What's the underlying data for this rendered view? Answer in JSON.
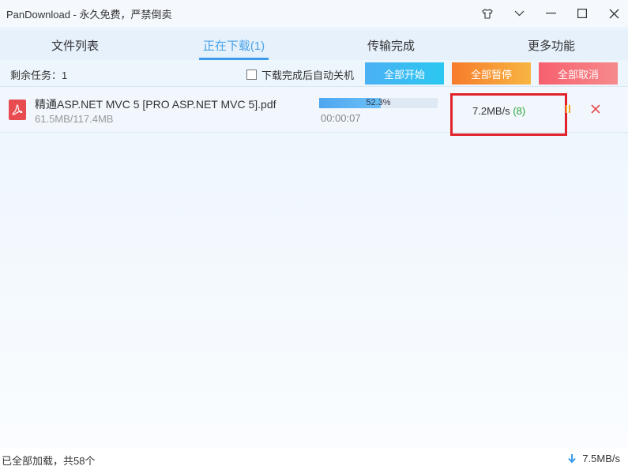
{
  "window": {
    "title": "PanDownload - 永久免费，严禁倒卖",
    "controls": [
      "shirt-skin-icon",
      "chevron-down-icon",
      "minimize-icon",
      "maximize-icon",
      "close-icon"
    ]
  },
  "tabs": [
    {
      "label": "文件列表",
      "active": false
    },
    {
      "label": "正在下载(1)",
      "active": true
    },
    {
      "label": "传输完成",
      "active": false
    },
    {
      "label": "更多功能",
      "active": false
    }
  ],
  "toolbar": {
    "remaining": "剩余任务：1",
    "auto_shutdown_label": "下载完成后自动关机",
    "auto_shutdown_checked": false,
    "start_all": "全部开始",
    "pause_all": "全部暂停",
    "cancel_all": "全部取消"
  },
  "downloads": [
    {
      "icon": "pdf-file-icon",
      "name": "精通ASP.NET MVC 5 [PRO ASP.NET MVC 5].pdf",
      "size": "61.5MB/117.4MB",
      "progress_percent": 52.3,
      "progress_label": "52.3%",
      "elapsed": "00:00:07",
      "speed": "7.2MB/s",
      "connections": "(8)"
    }
  ],
  "statusbar": {
    "left": "已全部加载，共58个",
    "right_speed": "7.5MB/s",
    "right_icon": "download-arrow-icon"
  },
  "colors": {
    "accent": "#3d9be9",
    "start": "#2bc7f1",
    "pause": "#f77c2c",
    "cancel": "#f8606e",
    "highlight": "#e2222b",
    "connections": "#2fa43a"
  }
}
